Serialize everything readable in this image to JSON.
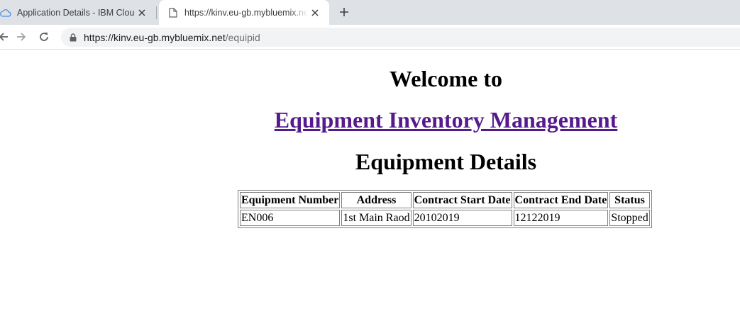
{
  "browser": {
    "tabs": [
      {
        "title": "Application Details - IBM Cloud",
        "favicon": "cloud-icon",
        "active": false
      },
      {
        "title": "https://kinv.eu-gb.mybluemix.net/equipid",
        "favicon": "page-icon",
        "active": true
      }
    ],
    "address_bar": {
      "host": "https://kinv.eu-gb.mybluemix.net",
      "path": "/equipid"
    }
  },
  "page": {
    "welcome": "Welcome to",
    "app_link": "Equipment Inventory Management",
    "heading": "Equipment Details",
    "table": {
      "headers": [
        "Equipment Number",
        "Address",
        "Contract Start Date",
        "Contract End Date",
        "Status"
      ],
      "rows": [
        [
          "EN006",
          "1st Main Raod",
          "20102019",
          "12122019",
          "Stopped"
        ]
      ]
    }
  },
  "colors": {
    "link_visited": "#551a8b",
    "tabstrip_bg": "#dee1e6",
    "omnibox_bg": "#f1f3f4"
  }
}
